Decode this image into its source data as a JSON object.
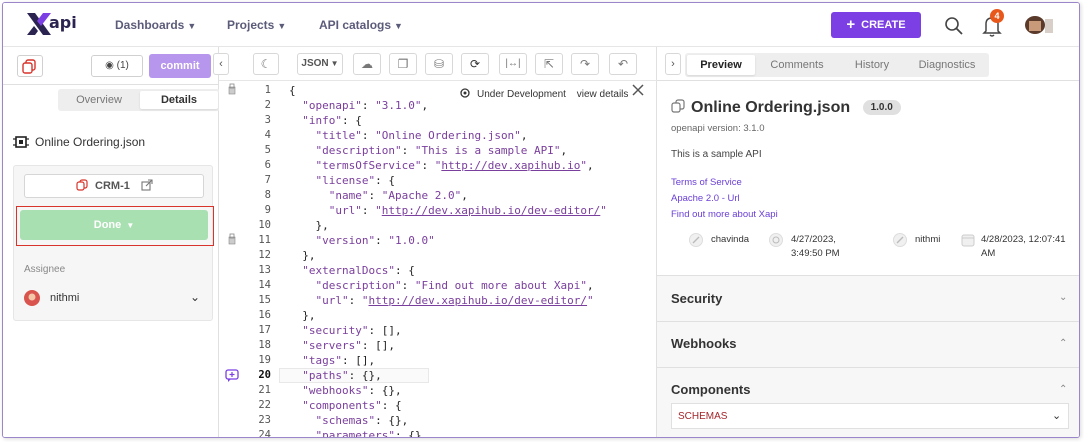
{
  "topnav": {
    "logo_text": "api",
    "items": [
      {
        "label": "Dashboards"
      },
      {
        "label": "Projects"
      },
      {
        "label": "API catalogs"
      }
    ],
    "create_label": "CREATE",
    "notifications_count": "4",
    "accent_color": "#7b3fe4"
  },
  "left": {
    "preview_count": "(1)",
    "commit_label": "commit",
    "tabs": [
      "Overview",
      "Details"
    ],
    "active_tab": "Details",
    "filename": "Online Ordering.json",
    "ticket": "CRM-1",
    "status": "Done",
    "assignee_label": "Assignee",
    "assignee_name": "nithmi"
  },
  "editor": {
    "format": "JSON",
    "current_line": 20,
    "status_text": "Under Development",
    "view_details_label": "view details",
    "lines": [
      {
        "n": "1",
        "html": "{"
      },
      {
        "n": "2",
        "html": "  <span class='s'>\"openapi\"</span>: <span class='s'>\"3.1.0\"</span>,"
      },
      {
        "n": "3",
        "html": "  <span class='s'>\"info\"</span>: {"
      },
      {
        "n": "4",
        "html": "    <span class='s'>\"title\"</span>: <span class='s'>\"Online Ordering.json\"</span>,"
      },
      {
        "n": "5",
        "html": "    <span class='s'>\"description\"</span>: <span class='s'>\"This is a sample API\"</span>,"
      },
      {
        "n": "6",
        "html": "    <span class='s'>\"termsOfService\"</span>: <span class='s'>\"</span><span class='u'>http://dev.xapihub.io</span><span class='s'>\"</span>,"
      },
      {
        "n": "7",
        "html": "    <span class='s'>\"license\"</span>: {"
      },
      {
        "n": "8",
        "html": "      <span class='s'>\"name\"</span>: <span class='s'>\"Apache 2.0\"</span>,"
      },
      {
        "n": "9",
        "html": "      <span class='s'>\"url\"</span>: <span class='s'>\"</span><span class='u'>http://dev.xapihub.io/dev-editor/</span><span class='s'>\"</span>"
      },
      {
        "n": "10",
        "html": "    },"
      },
      {
        "n": "11",
        "html": "    <span class='s'>\"version\"</span>: <span class='s'>\"1.0.0\"</span>"
      },
      {
        "n": "12",
        "html": "  },"
      },
      {
        "n": "13",
        "html": "  <span class='s'>\"externalDocs\"</span>: {"
      },
      {
        "n": "14",
        "html": "    <span class='s'>\"description\"</span>: <span class='s'>\"Find out more about Xapi\"</span>,"
      },
      {
        "n": "15",
        "html": "    <span class='s'>\"url\"</span>: <span class='s'>\"</span><span class='u'>http://dev.xapihub.io/dev-editor/</span><span class='s'>\"</span>"
      },
      {
        "n": "16",
        "html": "  },"
      },
      {
        "n": "17",
        "html": "  <span class='s'>\"security\"</span>: [],"
      },
      {
        "n": "18",
        "html": "  <span class='s'>\"servers\"</span>: [],"
      },
      {
        "n": "19",
        "html": "  <span class='s'>\"tags\"</span>: [],"
      },
      {
        "n": "20",
        "html": "  <span class='s'>\"paths\"</span>: {},"
      },
      {
        "n": "21",
        "html": "  <span class='s'>\"webhooks\"</span>: {},"
      },
      {
        "n": "22",
        "html": "  <span class='s'>\"components\"</span>: {"
      },
      {
        "n": "23",
        "html": "    <span class='s'>\"schemas\"</span>: {},"
      },
      {
        "n": "24",
        "html": "    <span class='s'>\"parameters\"</span>: {}"
      }
    ]
  },
  "right": {
    "tabs": [
      "Preview",
      "Comments",
      "History",
      "Diagnostics"
    ],
    "active_tab": "Preview",
    "title": "Online Ordering.json",
    "version": "1.0.0",
    "openapi_version": "openapi version: 3.1.0",
    "description": "This is a sample API",
    "links": [
      "Terms of Service",
      "Apache 2.0 - Url",
      "Find out more about Xapi"
    ],
    "created_by": "chavinda",
    "created_at_date": "4/27/2023,",
    "created_at_time": "3:49:50 PM",
    "updated_by": "nithmi",
    "updated_at_date": "4/28/2023, 12:07:41",
    "updated_at_time": "AM",
    "sections": [
      "Security",
      "Webhooks",
      "Components"
    ],
    "schemas_label": "SCHEMAS"
  }
}
